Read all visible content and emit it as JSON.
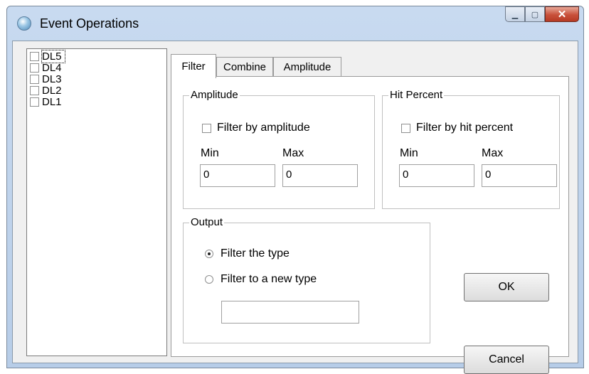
{
  "window": {
    "title": "Event Operations"
  },
  "list": {
    "items": [
      "DL5",
      "DL4",
      "DL3",
      "DL2",
      "DL1"
    ]
  },
  "tabs": [
    "Filter",
    "Combine",
    "Amplitude"
  ],
  "amplitude_group": {
    "title": "Amplitude",
    "checkbox_label": "Filter by amplitude",
    "min_label": "Min",
    "max_label": "Max",
    "min_value": "0",
    "max_value": "0"
  },
  "hit_group": {
    "title": "Hit Percent",
    "checkbox_label": "Filter by hit percent",
    "min_label": "Min",
    "max_label": "Max",
    "min_value": "0",
    "max_value": "0"
  },
  "output_group": {
    "title": "Output",
    "radio1": "Filter the type",
    "radio2": "Filter to a new type",
    "new_type_value": ""
  },
  "buttons": {
    "ok": "OK",
    "cancel": "Cancel"
  }
}
